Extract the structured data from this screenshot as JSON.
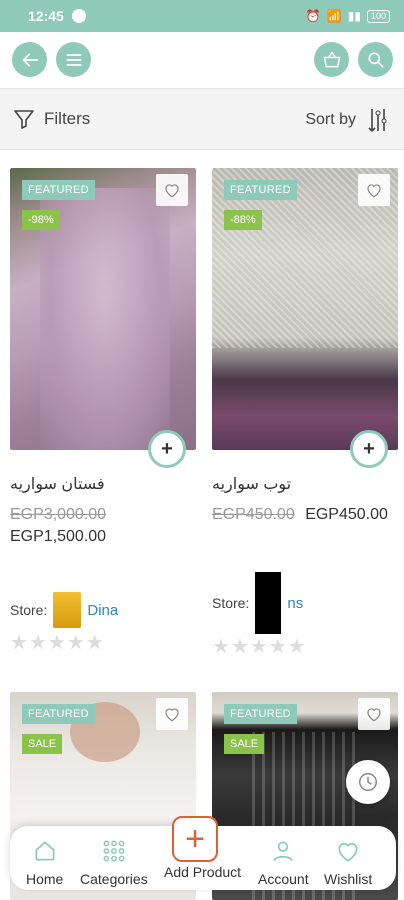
{
  "status": {
    "time": "12:45",
    "battery": "100"
  },
  "toolbar": {
    "filters_label": "Filters",
    "sort_label": "Sort by"
  },
  "products": [
    {
      "featured": "FEATURED",
      "discount": "-98%",
      "name": "فستان سواريه",
      "old_price": "EGP3,000.00",
      "price": "EGP1,500.00",
      "store_label": "Store:",
      "store_name": "Dina"
    },
    {
      "featured": "FEATURED",
      "discount": "-88%",
      "name": "توب سواريه",
      "old_price": "EGP450.00",
      "price": "EGP450.00",
      "store_label": "Store:",
      "store_name": "ns"
    },
    {
      "featured": "FEATURED",
      "badge": "SALE"
    },
    {
      "featured": "FEATURED",
      "badge": "SALE"
    }
  ],
  "nav": {
    "home": "Home",
    "categories": "Categories",
    "add_product": "Add Product",
    "account": "Account",
    "wishlist": "Wishlist"
  },
  "colors": {
    "accent": "#8fc9b9",
    "sale": "#8bc34a",
    "add": "#e06030",
    "link": "#2f86c8"
  }
}
